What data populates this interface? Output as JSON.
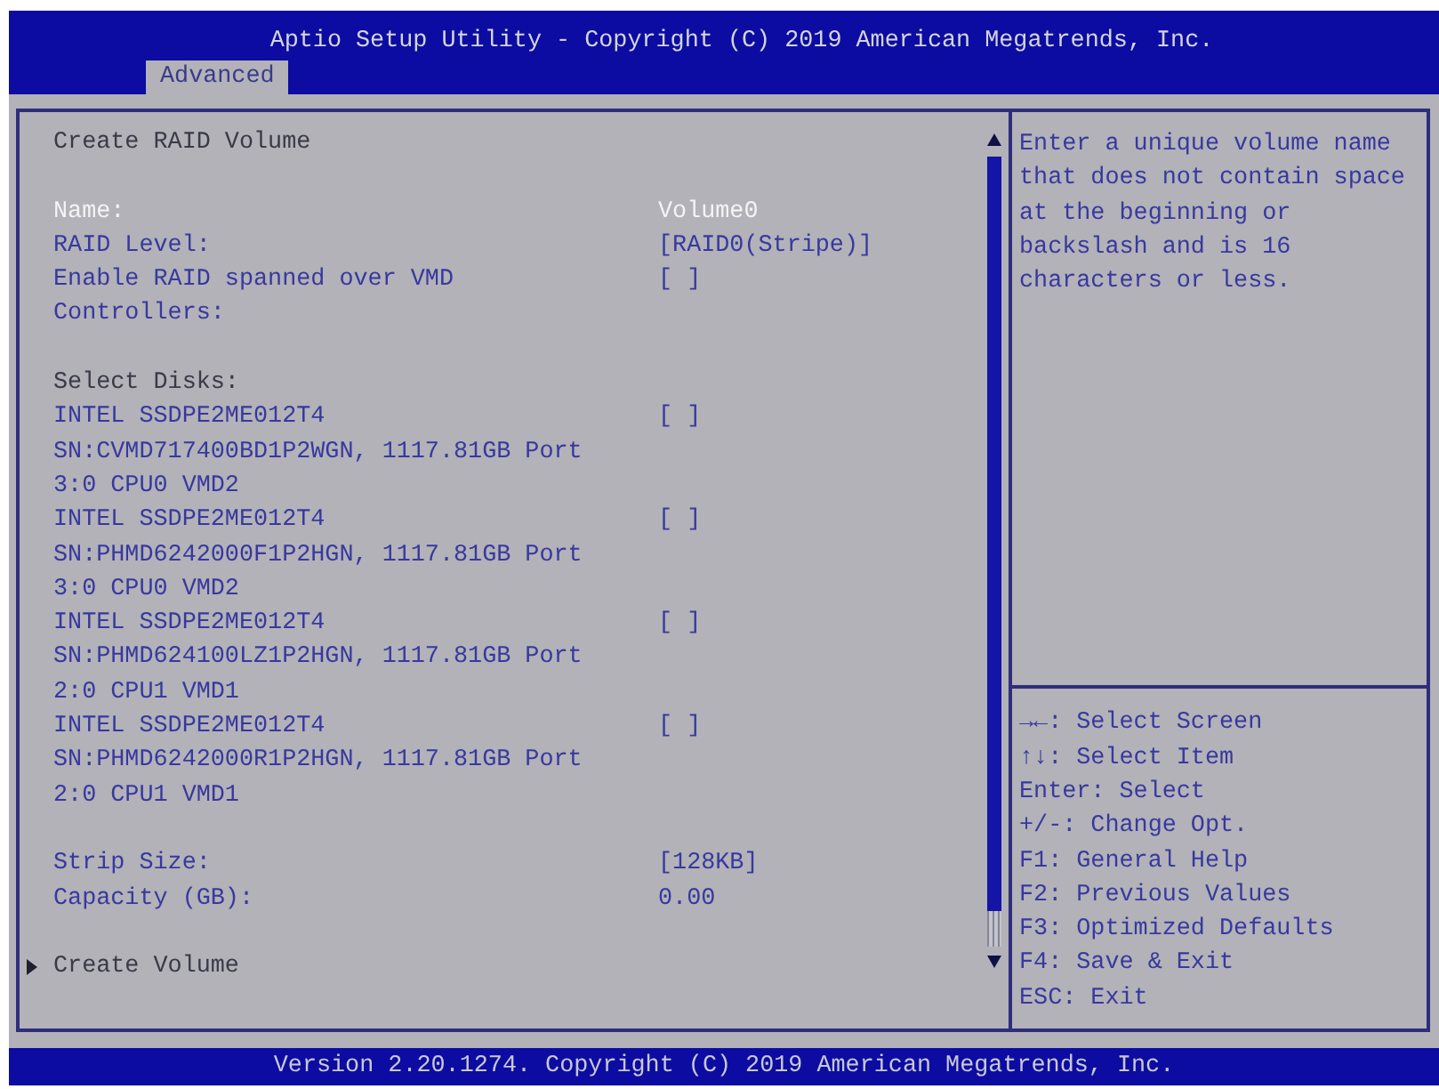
{
  "header": {
    "title": "Aptio Setup Utility - Copyright (C) 2019 American Megatrends, Inc."
  },
  "tabs": [
    {
      "label": "Advanced",
      "selected": true
    }
  ],
  "form": {
    "title": "Create RAID Volume",
    "groups": [
      {
        "items": [
          {
            "kind": "text",
            "label": "Name:",
            "value": "Volume0",
            "selected": true
          },
          {
            "kind": "option",
            "label": "RAID Level:",
            "value": "[RAID0(Stripe)]",
            "selected": false
          },
          {
            "kind": "checkbox",
            "label": "Enable RAID spanned over VMD Controllers:",
            "value": "[ ]",
            "checked": false,
            "selected": false
          }
        ]
      },
      {
        "items": [
          {
            "kind": "heading",
            "label": "Select Disks:"
          },
          {
            "kind": "checkbox",
            "label": "INTEL SSDPE2ME012T4 SN:CVMD717400BD1P2WGN, 1117.81GB Port 3:0 CPU0 VMD2",
            "value": "[ ]",
            "checked": false,
            "selected": false
          },
          {
            "kind": "checkbox",
            "label": "INTEL SSDPE2ME012T4 SN:PHMD6242000F1P2HGN, 1117.81GB Port 3:0 CPU0 VMD2",
            "value": "[ ]",
            "checked": false,
            "selected": false
          },
          {
            "kind": "checkbox",
            "label": "INTEL SSDPE2ME012T4 SN:PHMD624100LZ1P2HGN, 1117.81GB Port 2:0 CPU1 VMD1",
            "value": "[ ]",
            "checked": false,
            "selected": false
          },
          {
            "kind": "checkbox",
            "label": "INTEL SSDPE2ME012T4 SN:PHMD6242000R1P2HGN, 1117.81GB Port 2:0 CPU1 VMD1",
            "value": "[ ]",
            "checked": false,
            "selected": false
          }
        ]
      },
      {
        "items": [
          {
            "kind": "option",
            "label": "Strip Size:",
            "value": "[128KB]",
            "selected": false
          },
          {
            "kind": "readonly",
            "label": "Capacity (GB):",
            "value": "0.00"
          }
        ]
      },
      {
        "items": [
          {
            "kind": "submenu",
            "label": "Create Volume",
            "selected": false
          }
        ]
      }
    ]
  },
  "help": {
    "text": "Enter a unique volume name that does not contain space at the beginning or backslash and is 16 characters or less."
  },
  "key_help": [
    "→←: Select Screen",
    "↑↓: Select Item",
    "Enter: Select",
    "+/-: Change Opt.",
    "F1: General Help",
    "F2: Previous Values",
    "F3: Optimized Defaults",
    "F4: Save & Exit",
    "ESC: Exit"
  ],
  "footer": {
    "text": "Version 2.20.1274. Copyright (C) 2019 American Megatrends, Inc."
  }
}
